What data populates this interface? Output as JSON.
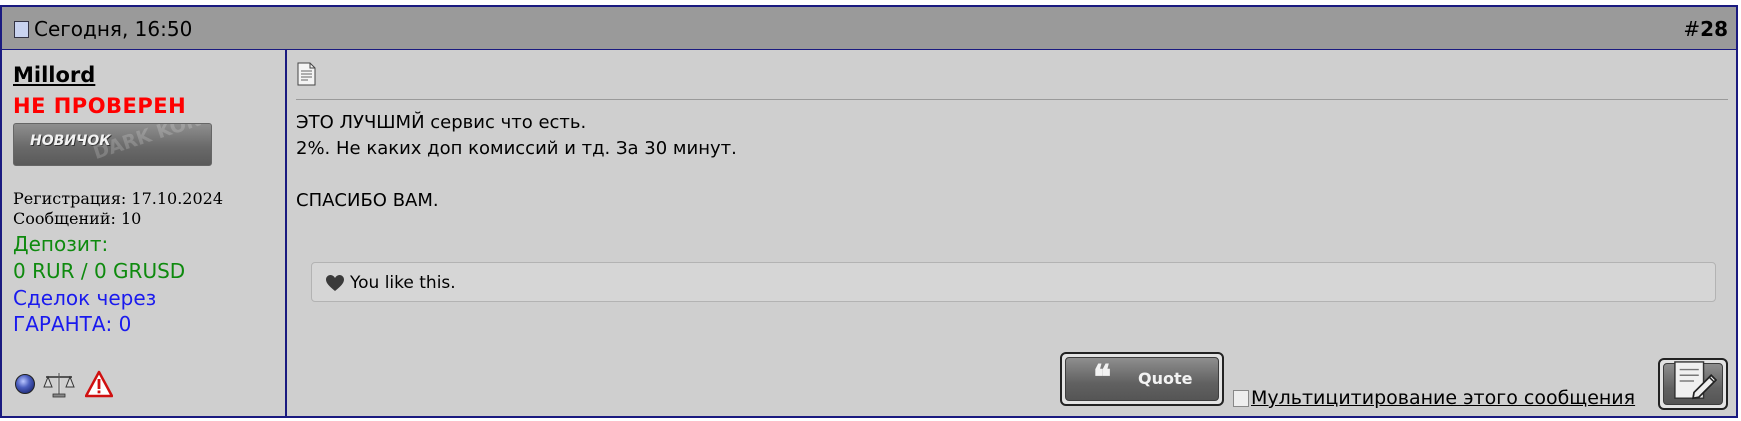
{
  "post": {
    "date": "Сегодня, 16:50",
    "number_prefix": "#",
    "number": "28"
  },
  "user": {
    "name": "Millord",
    "status": "НЕ ПРОВЕРЕН",
    "rank": "НОВИЧОК",
    "rank_watermark": "DARK KONS",
    "registration": "Регистрация: 17.10.2024",
    "posts": "Сообщений: 10",
    "deposit_label": "Депозит:",
    "deposit_value": "0 RUR / 0 GRUSD",
    "deals_label": "Сделок через",
    "deals_value": "ГАРАНТА: 0",
    "icons": [
      "status-dot-icon",
      "scales-icon",
      "warning-icon"
    ]
  },
  "message": {
    "lines": [
      "ЭТО ЛУЧШМЙ сервис что есть.",
      "2%. Не каких доп комиссий и тд. За 30 минут.",
      "",
      "СПАСИБО ВАМ."
    ]
  },
  "likes": {
    "text": "You like this."
  },
  "actions": {
    "quote_label": "Quote",
    "quote_mark": "❝",
    "multiquote_alt": "Мультицитирование этого сообщения"
  },
  "colors": {
    "border": "#1a1a80",
    "header_bg": "#9a9a9a",
    "post_bg": "#cfcfcf",
    "unverified": "#ff0000",
    "deposit": "#0e8a0e",
    "deals": "#1a1aee"
  }
}
